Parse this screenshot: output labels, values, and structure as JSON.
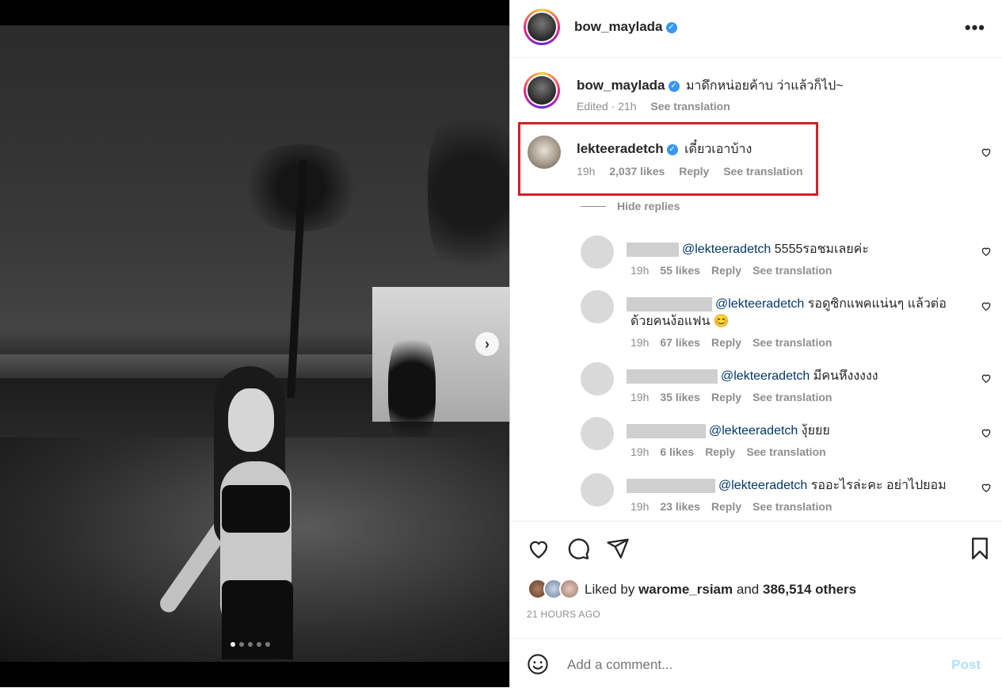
{
  "post": {
    "author": "bow_maylada",
    "more_icon": "more-horizontal-icon",
    "caption": {
      "username": "bow_maylada",
      "text": "มาดึกหน่อยค้าบ ว่าแล้วก็ไป~",
      "edited": "Edited · 21h",
      "see_translation": "See translation"
    },
    "carousel": {
      "slide_count": 5,
      "active_index": 0
    }
  },
  "highlighted_comment": {
    "username": "lekteeradetch",
    "text": "เดี๋ยวเอาบ้าง",
    "time": "19h",
    "likes": "2,037 likes",
    "reply_label": "Reply",
    "see_translation": "See translation"
  },
  "hide_replies": "Hide replies",
  "replies": [
    {
      "mention": "@lekteeradetch",
      "text": "5555รอชมเลยค่ะ",
      "time": "19h",
      "likes": "55 likes",
      "reply_label": "Reply",
      "see_translation": "See translation"
    },
    {
      "mention": "@lekteeradetch",
      "text": "รอดูซิกแพคแน่นๆ แล้วต่อ",
      "text2": "ด้วยคนง้อแฟน 😊",
      "time": "19h",
      "likes": "67 likes",
      "reply_label": "Reply",
      "see_translation": "See translation"
    },
    {
      "mention": "@lekteeradetch",
      "text": "มีคนหึงงงงง",
      "time": "19h",
      "likes": "35 likes",
      "reply_label": "Reply",
      "see_translation": "See translation"
    },
    {
      "mention": "@lekteeradetch",
      "text": "งุ้ยยย",
      "time": "19h",
      "likes": "6 likes",
      "reply_label": "Reply",
      "see_translation": "See translation"
    },
    {
      "mention": "@lekteeradetch",
      "text": "รออะไรล่ะคะ อย่าไปยอม",
      "time": "19h",
      "likes": "23 likes",
      "reply_label": "Reply",
      "see_translation": "See translation"
    }
  ],
  "liked_by": {
    "prefix": "Liked by",
    "user": "warome_rsiam",
    "and": "and",
    "others": "386,514 others"
  },
  "timestamp": "21 HOURS AGO",
  "comment_box": {
    "placeholder": "Add a comment...",
    "post_label": "Post",
    "emoji_icon": "emoji-icon"
  },
  "colors": {
    "highlight_box": "#d71f26",
    "verified": "#3897f0",
    "mention": "#00376b",
    "post_disabled": "#b2dffc"
  }
}
